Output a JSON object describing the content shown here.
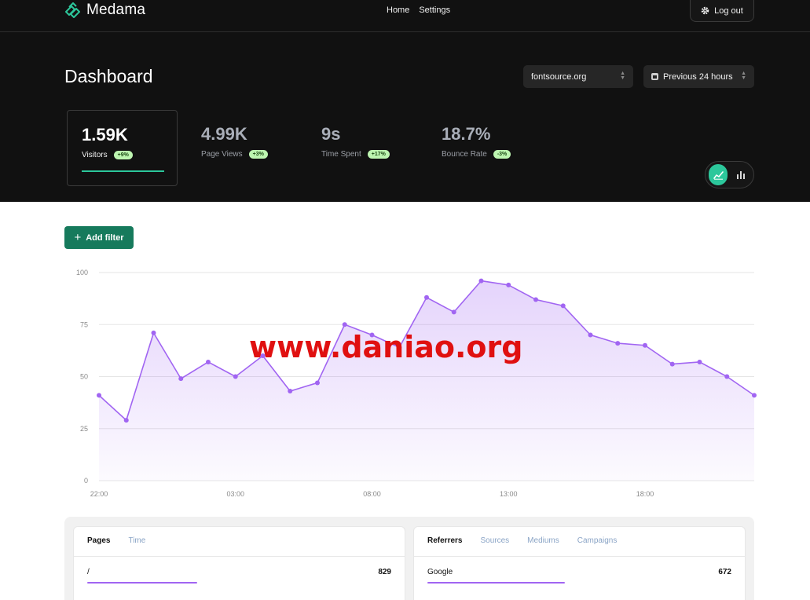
{
  "app": {
    "name": "Medama"
  },
  "nav": {
    "home": "Home",
    "settings": "Settings",
    "logout": "Log out"
  },
  "page": {
    "title": "Dashboard"
  },
  "filters": {
    "site": "fontsource.org",
    "range": "Previous 24 hours",
    "add_filter": "Add filter"
  },
  "stats": [
    {
      "value": "1.59K",
      "label": "Visitors",
      "badge": "+9%"
    },
    {
      "value": "4.99K",
      "label": "Page Views",
      "badge": "+3%"
    },
    {
      "value": "9s",
      "label": "Time Spent",
      "badge": "+17%"
    },
    {
      "value": "18.7%",
      "label": "Bounce Rate",
      "badge": "-3%"
    }
  ],
  "colors": {
    "accent": "#2cc79b",
    "line": "#a165f2",
    "header_bg": "#111111",
    "button": "#167a5c"
  },
  "icons": {
    "logo": "medama-logo-icon",
    "logout": "gear-icon",
    "calendar": "calendar-icon",
    "line_chart": "line-chart-icon",
    "bar_chart": "bar-chart-icon",
    "plus": "plus-icon"
  },
  "chart_data": {
    "type": "area",
    "x_ticks": [
      "22:00",
      "03:00",
      "08:00",
      "13:00",
      "18:00"
    ],
    "x_tick_index": [
      0,
      5,
      10,
      15,
      20
    ],
    "y_ticks": [
      0,
      25,
      50,
      75,
      100
    ],
    "ylim": [
      0,
      100
    ],
    "grid": true,
    "series": [
      {
        "values": [
          41,
          29,
          71,
          49,
          57,
          50,
          60,
          43,
          47,
          75,
          70,
          64,
          88,
          81,
          96,
          94,
          87,
          84,
          70,
          66,
          65,
          56,
          57,
          50,
          41
        ]
      }
    ]
  },
  "panels": {
    "left": {
      "tabs": [
        "Pages",
        "Time"
      ],
      "rows": [
        {
          "label": "/",
          "value": "829",
          "fraction": 0.36
        }
      ]
    },
    "right": {
      "tabs": [
        "Referrers",
        "Sources",
        "Mediums",
        "Campaigns"
      ],
      "rows": [
        {
          "label": "Google",
          "value": "672",
          "fraction": 0.45
        }
      ]
    }
  },
  "watermark": "www.daniao.org"
}
